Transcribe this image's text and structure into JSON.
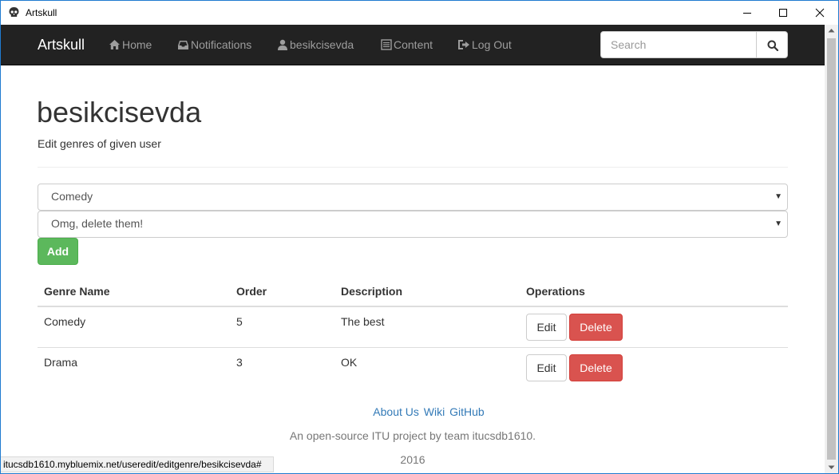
{
  "window": {
    "title": "Artskull",
    "icon": "skull-icon"
  },
  "navbar": {
    "brand": "Artskull",
    "items": [
      {
        "label": "Home",
        "icon": "home-icon"
      },
      {
        "label": "Notifications",
        "icon": "inbox-icon"
      },
      {
        "label": "besikcisevda",
        "icon": "user-icon"
      },
      {
        "label": "Content",
        "icon": "list-icon"
      },
      {
        "label": "Log Out",
        "icon": "logout-icon"
      }
    ],
    "search": {
      "placeholder": "Search",
      "value": "",
      "icon": "search-icon"
    }
  },
  "page": {
    "title": "besikcisevda",
    "subtitle": "Edit genres of given user"
  },
  "form": {
    "genre_select": "Comedy",
    "description_select": "Omg, delete them!",
    "add_label": "Add"
  },
  "table": {
    "headers": [
      "Genre Name",
      "Order",
      "Description",
      "Operations"
    ],
    "rows": [
      {
        "genre": "Comedy",
        "order": "5",
        "description": "The best",
        "edit": "Edit",
        "delete": "Delete"
      },
      {
        "genre": "Drama",
        "order": "3",
        "description": "OK",
        "edit": "Edit",
        "delete": "Delete"
      }
    ]
  },
  "footer": {
    "links": [
      "About Us",
      "Wiki",
      "GitHub"
    ],
    "text": "An open-source ITU project by team itucsdb1610.",
    "year": "2016"
  },
  "status_bar": {
    "url": "itucsdb1610.mybluemix.net/useredit/editgenre/besikcisevda#"
  },
  "colors": {
    "navbar_bg": "#222222",
    "add_button": "#5cb85c",
    "delete_button": "#d9534f",
    "link": "#337ab7"
  }
}
